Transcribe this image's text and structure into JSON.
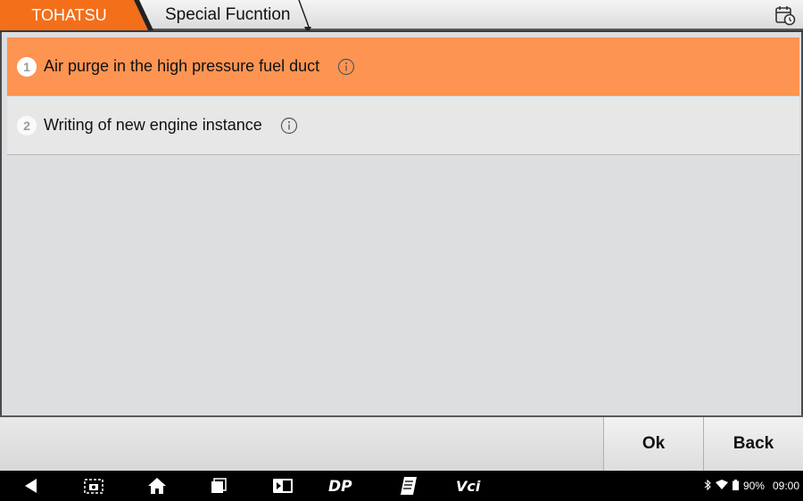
{
  "header": {
    "brand_tab": "TOHATSU",
    "page_tab": "Special Fucntion",
    "calendar_icon": "calendar-clock-icon"
  },
  "list": {
    "items": [
      {
        "number": "1",
        "label": "Air purge in the high pressure fuel duct",
        "selected": true
      },
      {
        "number": "2",
        "label": "Writing of new engine instance",
        "selected": false
      }
    ]
  },
  "actions": {
    "ok_label": "Ok",
    "back_label": "Back"
  },
  "navbar": {
    "icons": [
      "back-icon",
      "screenshot-icon",
      "home-icon",
      "recents-icon",
      "vci-manager-icon",
      "dp-icon",
      "notes-icon",
      "vci-icon"
    ],
    "dp_label": "DP",
    "vci_label": "Vci"
  },
  "status": {
    "battery": "90%",
    "time": "09:00"
  },
  "colors": {
    "accent": "#fd9452",
    "brand_tab": "#f36f1a"
  }
}
